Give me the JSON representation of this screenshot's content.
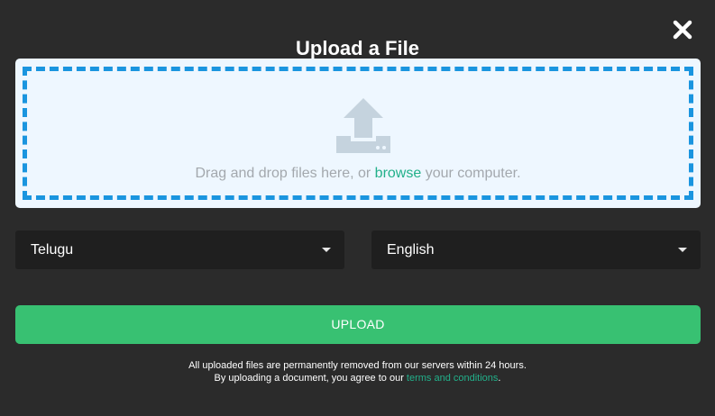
{
  "modal": {
    "title": "Upload a File",
    "close_icon": "close-icon"
  },
  "dropzone": {
    "icon": "upload-icon",
    "text_before": "Drag and drop files here, or ",
    "browse_label": "browse",
    "text_after": " your computer."
  },
  "languages": {
    "source": "Telugu",
    "target": "English"
  },
  "upload_button": {
    "label": "UPLOAD"
  },
  "notice": {
    "line1": "All uploaded files are permanently removed from our servers within 24 hours.",
    "line2_before": "By uploading a document, you agree to our ",
    "terms_label": "terms and conditions",
    "line2_after": "."
  },
  "colors": {
    "background": "#2b2b2b",
    "dropzone_bg": "#eef7ff",
    "dashed_border": "#1a95df",
    "link": "#22b08a",
    "upload_button": "#38c172",
    "select_bg": "#1f1f1f",
    "icon": "#c5d3de"
  }
}
